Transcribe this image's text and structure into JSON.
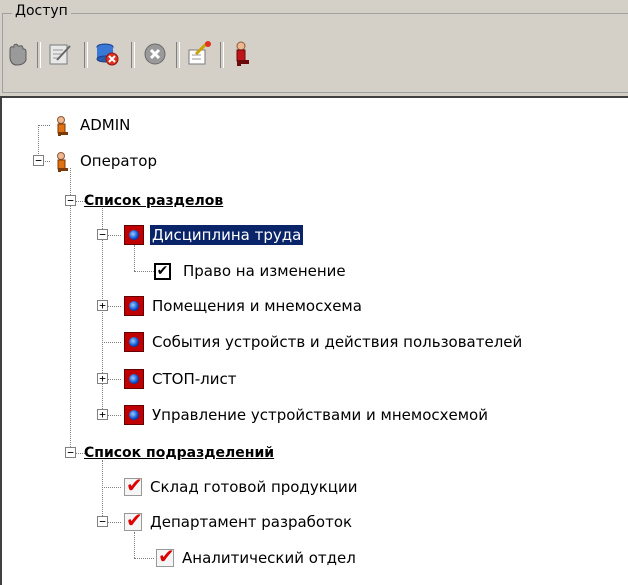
{
  "group_title": "Доступ",
  "toolbar": {
    "buttons": [
      "hand-icon",
      "edit-icon",
      "delete-db-icon",
      "cancel-icon",
      "properties-icon",
      "user-icon"
    ]
  },
  "tree": {
    "users": [
      {
        "label": "ADMIN"
      },
      {
        "label": "Оператор"
      }
    ],
    "sections_header": "Список разделов",
    "sections": [
      {
        "label": "Дисциплина труда",
        "selected": true
      },
      {
        "label": "Помещения и мнемосхема"
      },
      {
        "label": "События устройств и действия пользователей"
      },
      {
        "label": "СТОП-лист"
      },
      {
        "label": "Управление устройствами и мнемосхемой"
      }
    ],
    "permission": {
      "label": "Право на изменение",
      "checked": true
    },
    "divisions_header": "Список подразделений",
    "divisions": [
      {
        "label": "Склад готовой продукции"
      },
      {
        "label": "Департамент разработок"
      },
      {
        "label": "Аналитический отдел"
      }
    ]
  },
  "colors": {
    "selection": "#0a246a",
    "module_icon": "#c00000",
    "check": "#dd0000"
  }
}
